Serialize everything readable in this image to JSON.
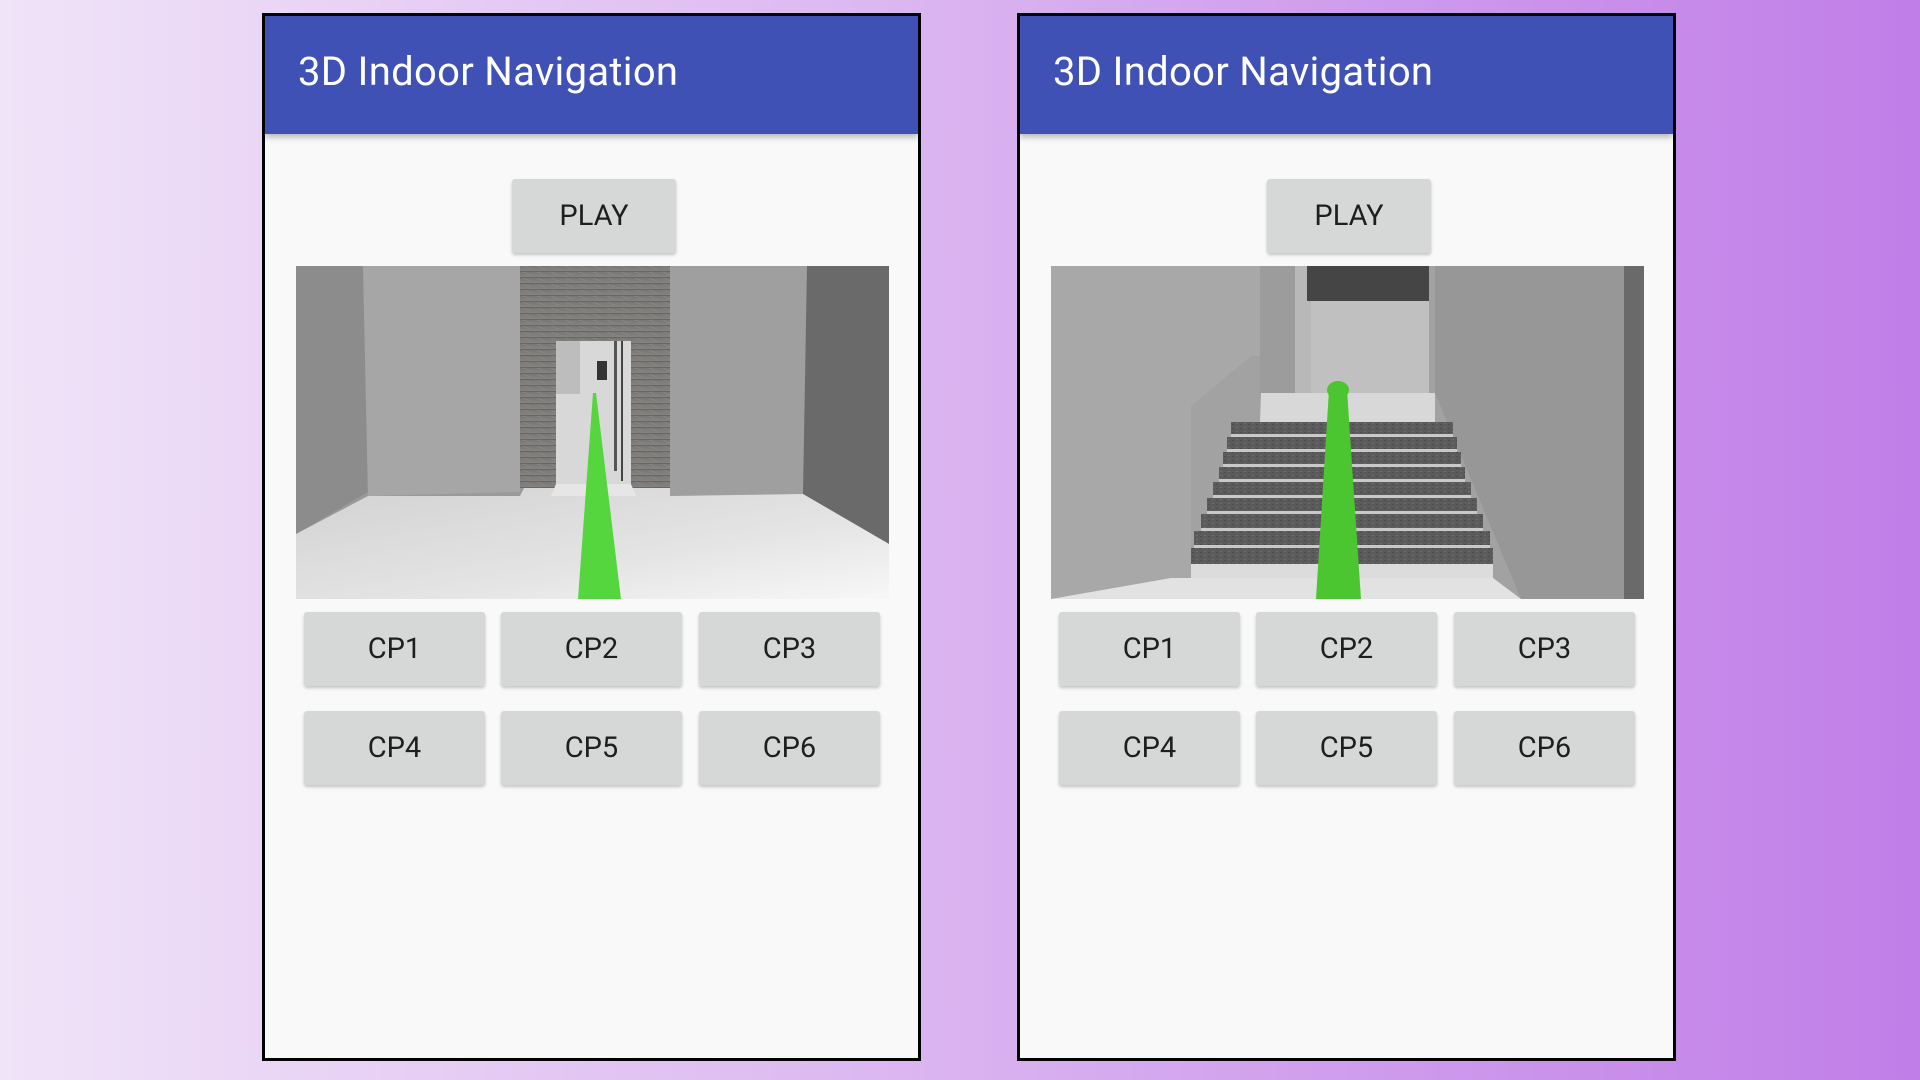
{
  "screens": [
    {
      "title": "3D Indoor Navigation",
      "play_label": "PLAY",
      "scene": "corridor-with-green-path",
      "checkpoints": [
        "CP1",
        "CP2",
        "CP3",
        "CP4",
        "CP5",
        "CP6"
      ]
    },
    {
      "title": "3D Indoor Navigation",
      "play_label": "PLAY",
      "scene": "staircase-with-green-path",
      "checkpoints": [
        "CP1",
        "CP2",
        "CP3",
        "CP4",
        "CP5",
        "CP6"
      ]
    }
  ],
  "colors": {
    "app_bar": "#3f51b5",
    "button_bg": "#d6d7d7",
    "path_green": "#55d63e"
  }
}
